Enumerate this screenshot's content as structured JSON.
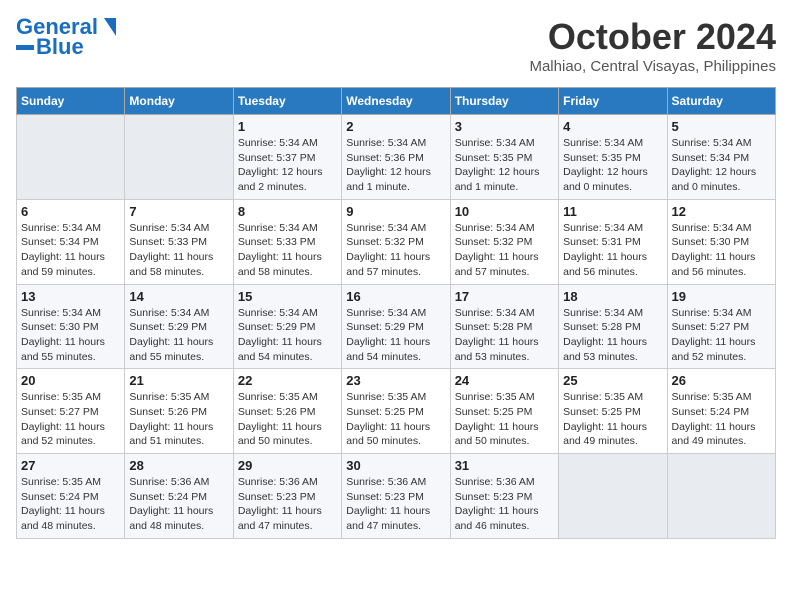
{
  "logo": {
    "line1": "General",
    "line2": "Blue"
  },
  "title": "October 2024",
  "subtitle": "Malhiao, Central Visayas, Philippines",
  "days_of_week": [
    "Sunday",
    "Monday",
    "Tuesday",
    "Wednesday",
    "Thursday",
    "Friday",
    "Saturday"
  ],
  "weeks": [
    [
      {
        "day": "",
        "sunrise": "",
        "sunset": "",
        "daylight": ""
      },
      {
        "day": "",
        "sunrise": "",
        "sunset": "",
        "daylight": ""
      },
      {
        "day": "1",
        "sunrise": "Sunrise: 5:34 AM",
        "sunset": "Sunset: 5:37 PM",
        "daylight": "Daylight: 12 hours and 2 minutes."
      },
      {
        "day": "2",
        "sunrise": "Sunrise: 5:34 AM",
        "sunset": "Sunset: 5:36 PM",
        "daylight": "Daylight: 12 hours and 1 minute."
      },
      {
        "day": "3",
        "sunrise": "Sunrise: 5:34 AM",
        "sunset": "Sunset: 5:35 PM",
        "daylight": "Daylight: 12 hours and 1 minute."
      },
      {
        "day": "4",
        "sunrise": "Sunrise: 5:34 AM",
        "sunset": "Sunset: 5:35 PM",
        "daylight": "Daylight: 12 hours and 0 minutes."
      },
      {
        "day": "5",
        "sunrise": "Sunrise: 5:34 AM",
        "sunset": "Sunset: 5:34 PM",
        "daylight": "Daylight: 12 hours and 0 minutes."
      }
    ],
    [
      {
        "day": "6",
        "sunrise": "Sunrise: 5:34 AM",
        "sunset": "Sunset: 5:34 PM",
        "daylight": "Daylight: 11 hours and 59 minutes."
      },
      {
        "day": "7",
        "sunrise": "Sunrise: 5:34 AM",
        "sunset": "Sunset: 5:33 PM",
        "daylight": "Daylight: 11 hours and 58 minutes."
      },
      {
        "day": "8",
        "sunrise": "Sunrise: 5:34 AM",
        "sunset": "Sunset: 5:33 PM",
        "daylight": "Daylight: 11 hours and 58 minutes."
      },
      {
        "day": "9",
        "sunrise": "Sunrise: 5:34 AM",
        "sunset": "Sunset: 5:32 PM",
        "daylight": "Daylight: 11 hours and 57 minutes."
      },
      {
        "day": "10",
        "sunrise": "Sunrise: 5:34 AM",
        "sunset": "Sunset: 5:32 PM",
        "daylight": "Daylight: 11 hours and 57 minutes."
      },
      {
        "day": "11",
        "sunrise": "Sunrise: 5:34 AM",
        "sunset": "Sunset: 5:31 PM",
        "daylight": "Daylight: 11 hours and 56 minutes."
      },
      {
        "day": "12",
        "sunrise": "Sunrise: 5:34 AM",
        "sunset": "Sunset: 5:30 PM",
        "daylight": "Daylight: 11 hours and 56 minutes."
      }
    ],
    [
      {
        "day": "13",
        "sunrise": "Sunrise: 5:34 AM",
        "sunset": "Sunset: 5:30 PM",
        "daylight": "Daylight: 11 hours and 55 minutes."
      },
      {
        "day": "14",
        "sunrise": "Sunrise: 5:34 AM",
        "sunset": "Sunset: 5:29 PM",
        "daylight": "Daylight: 11 hours and 55 minutes."
      },
      {
        "day": "15",
        "sunrise": "Sunrise: 5:34 AM",
        "sunset": "Sunset: 5:29 PM",
        "daylight": "Daylight: 11 hours and 54 minutes."
      },
      {
        "day": "16",
        "sunrise": "Sunrise: 5:34 AM",
        "sunset": "Sunset: 5:29 PM",
        "daylight": "Daylight: 11 hours and 54 minutes."
      },
      {
        "day": "17",
        "sunrise": "Sunrise: 5:34 AM",
        "sunset": "Sunset: 5:28 PM",
        "daylight": "Daylight: 11 hours and 53 minutes."
      },
      {
        "day": "18",
        "sunrise": "Sunrise: 5:34 AM",
        "sunset": "Sunset: 5:28 PM",
        "daylight": "Daylight: 11 hours and 53 minutes."
      },
      {
        "day": "19",
        "sunrise": "Sunrise: 5:34 AM",
        "sunset": "Sunset: 5:27 PM",
        "daylight": "Daylight: 11 hours and 52 minutes."
      }
    ],
    [
      {
        "day": "20",
        "sunrise": "Sunrise: 5:35 AM",
        "sunset": "Sunset: 5:27 PM",
        "daylight": "Daylight: 11 hours and 52 minutes."
      },
      {
        "day": "21",
        "sunrise": "Sunrise: 5:35 AM",
        "sunset": "Sunset: 5:26 PM",
        "daylight": "Daylight: 11 hours and 51 minutes."
      },
      {
        "day": "22",
        "sunrise": "Sunrise: 5:35 AM",
        "sunset": "Sunset: 5:26 PM",
        "daylight": "Daylight: 11 hours and 50 minutes."
      },
      {
        "day": "23",
        "sunrise": "Sunrise: 5:35 AM",
        "sunset": "Sunset: 5:25 PM",
        "daylight": "Daylight: 11 hours and 50 minutes."
      },
      {
        "day": "24",
        "sunrise": "Sunrise: 5:35 AM",
        "sunset": "Sunset: 5:25 PM",
        "daylight": "Daylight: 11 hours and 50 minutes."
      },
      {
        "day": "25",
        "sunrise": "Sunrise: 5:35 AM",
        "sunset": "Sunset: 5:25 PM",
        "daylight": "Daylight: 11 hours and 49 minutes."
      },
      {
        "day": "26",
        "sunrise": "Sunrise: 5:35 AM",
        "sunset": "Sunset: 5:24 PM",
        "daylight": "Daylight: 11 hours and 49 minutes."
      }
    ],
    [
      {
        "day": "27",
        "sunrise": "Sunrise: 5:35 AM",
        "sunset": "Sunset: 5:24 PM",
        "daylight": "Daylight: 11 hours and 48 minutes."
      },
      {
        "day": "28",
        "sunrise": "Sunrise: 5:36 AM",
        "sunset": "Sunset: 5:24 PM",
        "daylight": "Daylight: 11 hours and 48 minutes."
      },
      {
        "day": "29",
        "sunrise": "Sunrise: 5:36 AM",
        "sunset": "Sunset: 5:23 PM",
        "daylight": "Daylight: 11 hours and 47 minutes."
      },
      {
        "day": "30",
        "sunrise": "Sunrise: 5:36 AM",
        "sunset": "Sunset: 5:23 PM",
        "daylight": "Daylight: 11 hours and 47 minutes."
      },
      {
        "day": "31",
        "sunrise": "Sunrise: 5:36 AM",
        "sunset": "Sunset: 5:23 PM",
        "daylight": "Daylight: 11 hours and 46 minutes."
      },
      {
        "day": "",
        "sunrise": "",
        "sunset": "",
        "daylight": ""
      },
      {
        "day": "",
        "sunrise": "",
        "sunset": "",
        "daylight": ""
      }
    ]
  ]
}
